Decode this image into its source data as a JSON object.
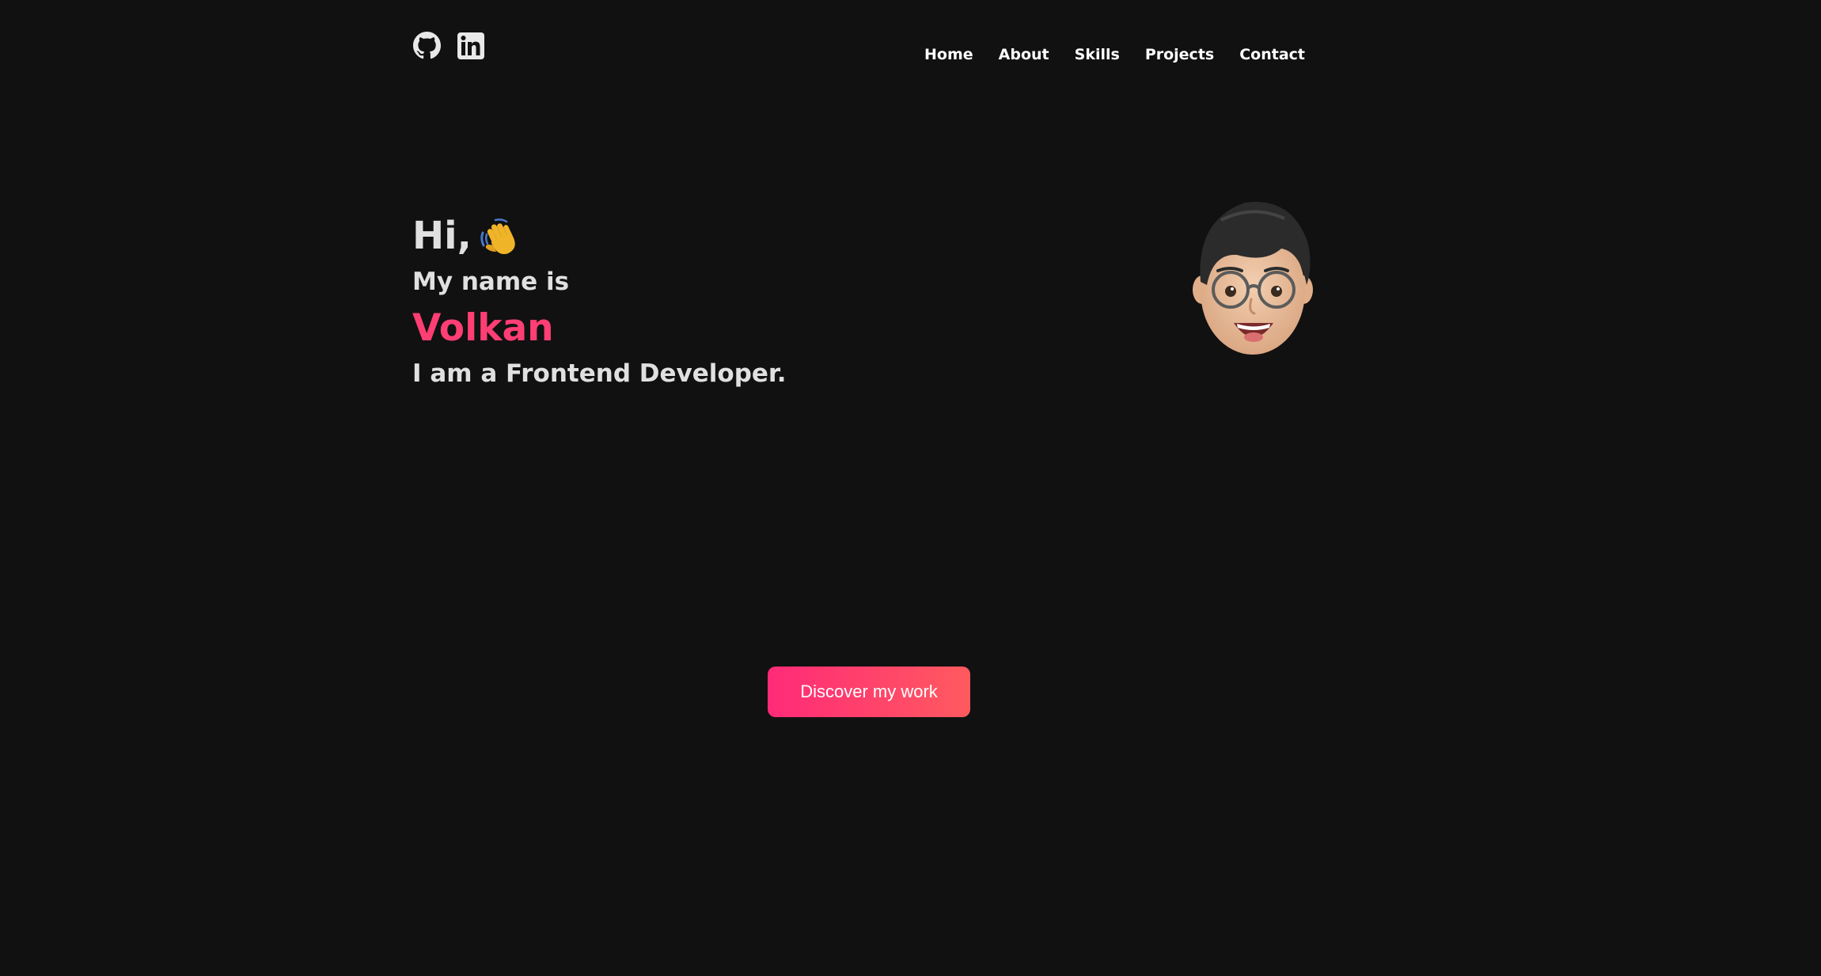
{
  "header": {
    "social": [
      {
        "icon": "github-icon"
      },
      {
        "icon": "linkedin-icon"
      }
    ],
    "nav": [
      "Home",
      "About",
      "Skills",
      "Projects",
      "Contact"
    ]
  },
  "hero": {
    "greeting": "Hi,",
    "greeting_icon": "waving-hand-icon",
    "intro": "My name is",
    "name": "Volkan",
    "role": "I am a Frontend Developer.",
    "avatar_icon": "memoji-avatar"
  },
  "cta": {
    "label": "Discover my work"
  },
  "colors": {
    "background": "#111111",
    "text": "#e0e0e0",
    "accent": "#ff3e74",
    "button_gradient_start": "#ff2a78",
    "button_gradient_end": "#ff5a5f"
  }
}
